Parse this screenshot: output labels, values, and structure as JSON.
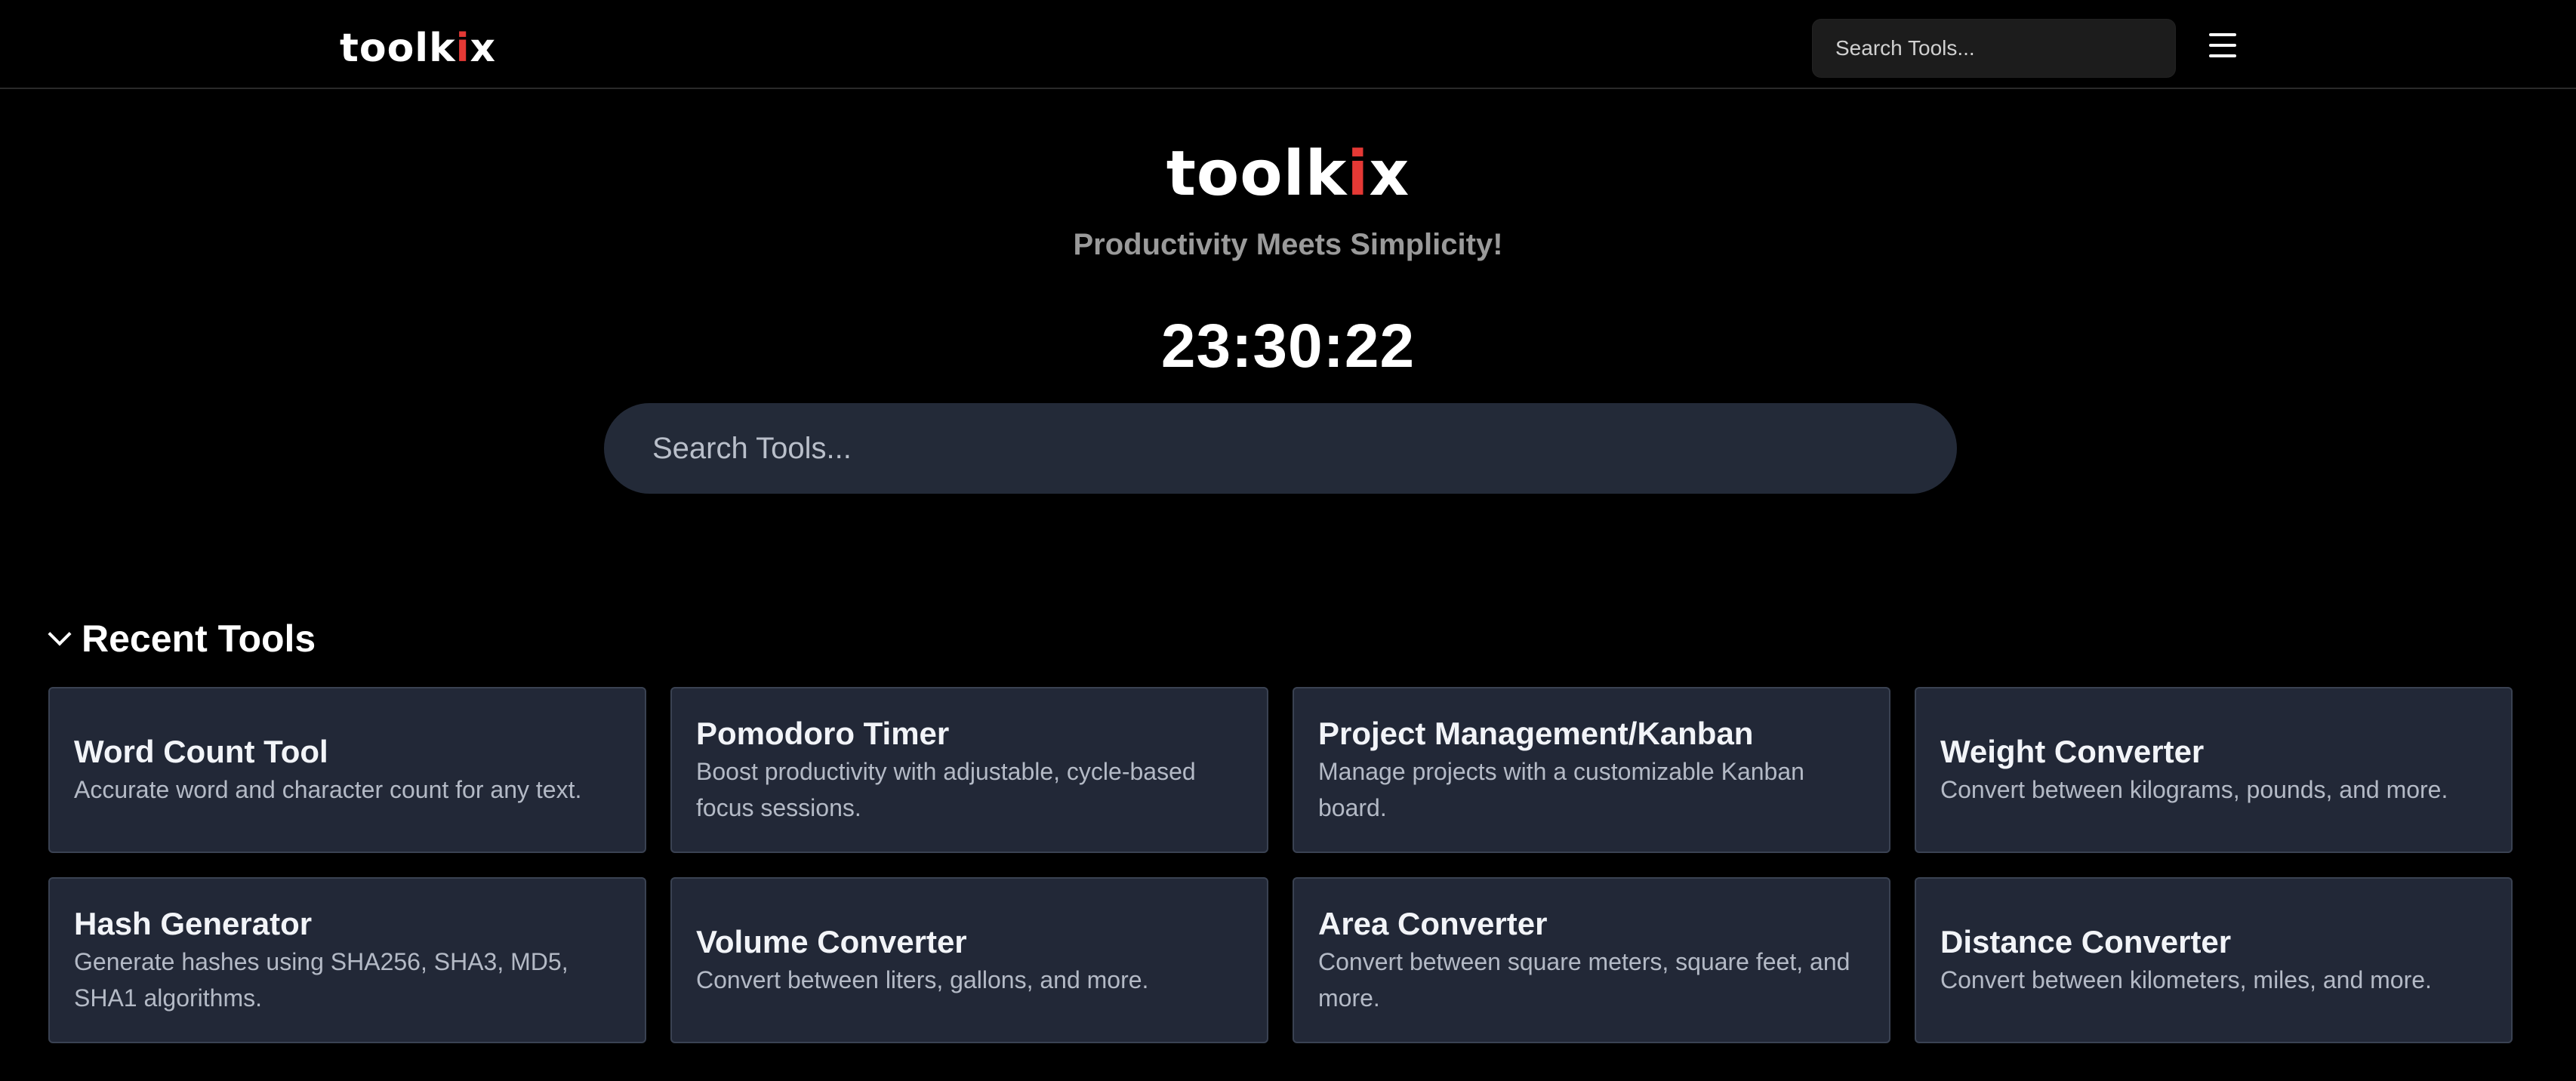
{
  "header": {
    "logo_main": "toolk",
    "logo_accent": "i",
    "logo_end": "x",
    "search_placeholder": "Search Tools...",
    "menu_icon": "hamburger-menu-icon"
  },
  "hero": {
    "logo_main": "toolk",
    "logo_accent": "i",
    "logo_end": "x",
    "tagline": "Productivity Meets Simplicity!",
    "clock": "23:30:22",
    "search_placeholder": "Search Tools..."
  },
  "recent": {
    "title": "Recent Tools",
    "chevron_icon": "chevron-down-icon",
    "tools": [
      {
        "title": "Word Count Tool",
        "desc": "Accurate word and character count for any text."
      },
      {
        "title": "Pomodoro Timer",
        "desc": "Boost productivity with adjustable, cycle-based focus sessions."
      },
      {
        "title": "Project Management/Kanban",
        "desc": "Manage projects with a customizable Kanban board."
      },
      {
        "title": "Weight Converter",
        "desc": "Convert between kilograms, pounds, and more."
      },
      {
        "title": "Hash Generator",
        "desc": "Generate hashes using SHA256, SHA3, MD5, SHA1 algorithms."
      },
      {
        "title": "Volume Converter",
        "desc": "Convert between liters, gallons, and more."
      },
      {
        "title": "Area Converter",
        "desc": "Convert between square meters, square feet, and more."
      },
      {
        "title": "Distance Converter",
        "desc": "Convert between kilometers, miles, and more."
      }
    ]
  },
  "colors": {
    "background": "#000000",
    "accent": "#e53935",
    "card_bg": "#222837",
    "search_bg": "#232a38"
  }
}
